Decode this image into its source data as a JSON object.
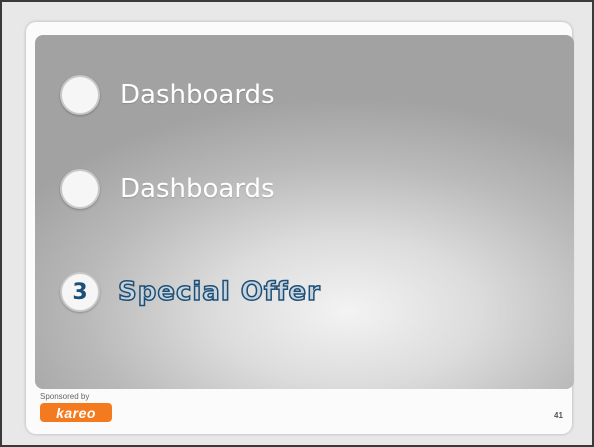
{
  "slide": {
    "items": [
      {
        "marker": "",
        "label": "Dashboards"
      },
      {
        "marker": "",
        "label": "Dashboards"
      },
      {
        "marker": "3",
        "label": "Special Offer"
      }
    ],
    "sponsor_text": "Sponsored by",
    "logo_text": "kareo",
    "page_number": "41"
  },
  "colors": {
    "accent": "#1c4f77",
    "logo": "#f47a20",
    "panel_edge": "#a2a2a2",
    "panel_center": "#f3f3f3"
  }
}
